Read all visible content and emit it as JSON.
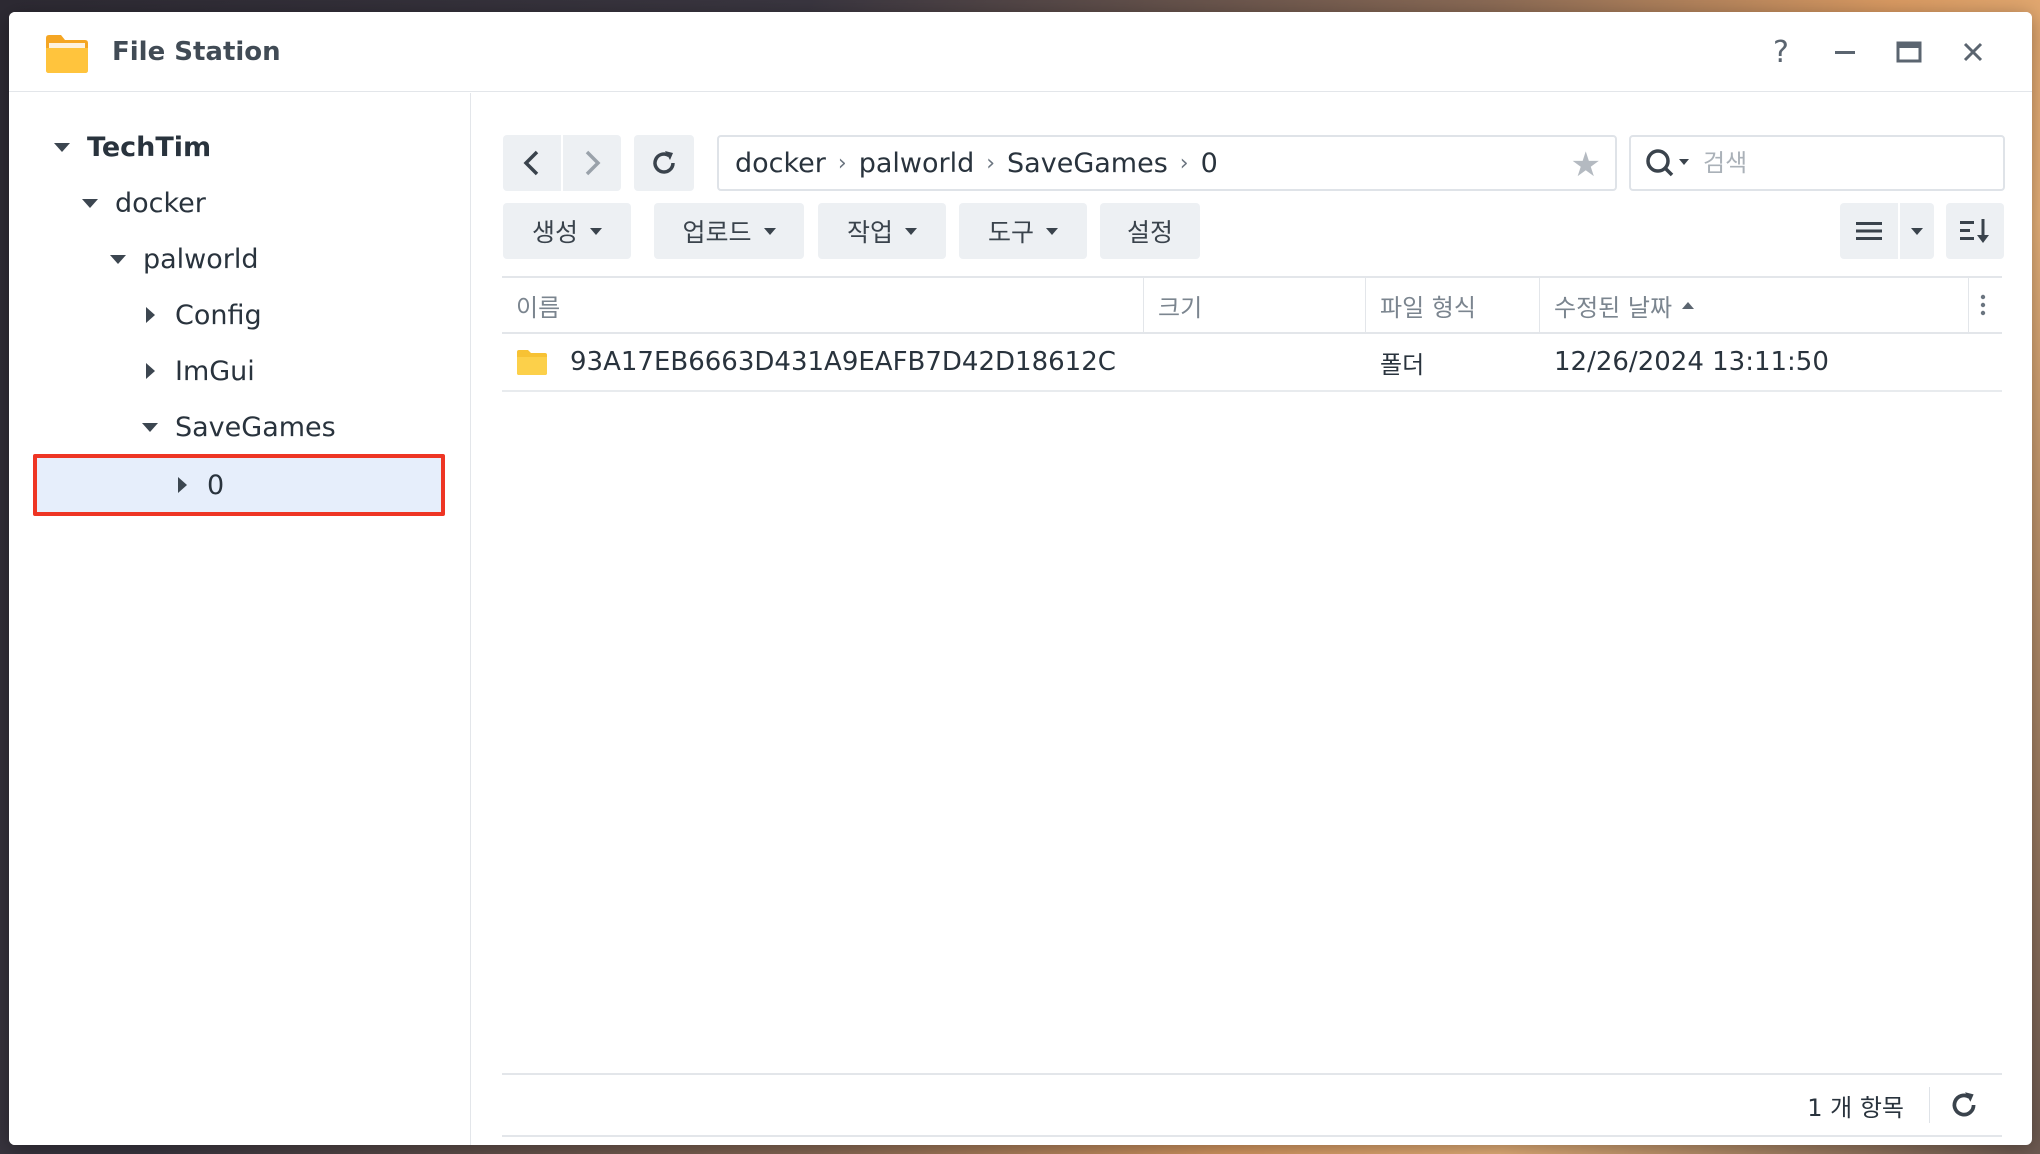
{
  "window": {
    "title": "File Station"
  },
  "sidebar": {
    "root": "TechTim",
    "items": [
      {
        "label": "docker"
      },
      {
        "label": "palworld"
      },
      {
        "label": "Config"
      },
      {
        "label": "ImGui"
      },
      {
        "label": "SaveGames"
      },
      {
        "label": "0"
      }
    ]
  },
  "toolbar": {
    "path": [
      "docker",
      "palworld",
      "SaveGames",
      "0"
    ],
    "search_placeholder": "검색",
    "buttons": {
      "create": "생성",
      "upload": "업로드",
      "action": "작업",
      "tools": "도구",
      "settings": "설정"
    }
  },
  "table": {
    "columns": [
      "이름",
      "크기",
      "파일 형식",
      "수정된 날짜"
    ],
    "rows": [
      {
        "name": "93A17EB6663D431A9EAFB7D42D18612C",
        "size": "",
        "type": "폴더",
        "modified": "12/26/2024 13:11:50"
      }
    ]
  },
  "status": {
    "count": "1 개 항목"
  },
  "colors": {
    "accent": "#ee3524",
    "selected_bg": "#e6eefb",
    "folder": "#f7c234"
  }
}
